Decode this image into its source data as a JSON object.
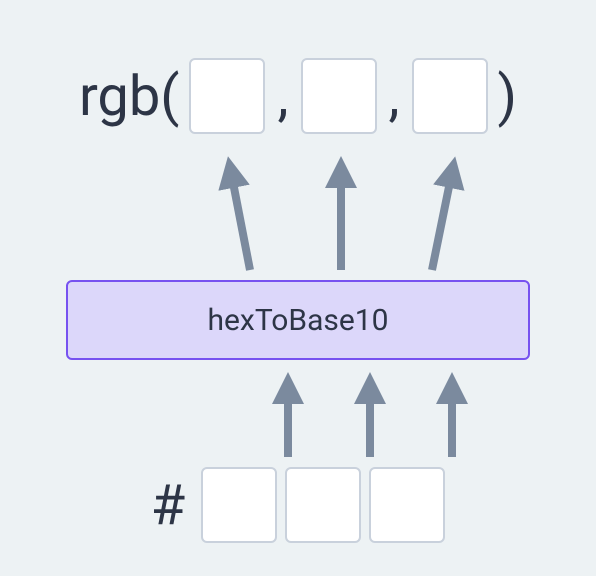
{
  "diagram": {
    "top": {
      "prefix": "rgb(",
      "comma": ",",
      "suffix": ")",
      "slots": [
        "",
        "",
        ""
      ]
    },
    "function_box": {
      "label": "hexToBase10"
    },
    "bottom": {
      "hash": "#",
      "slots": [
        "",
        "",
        ""
      ]
    },
    "arrows": {
      "color": "#7b8a9e",
      "top_from_box_count": 3,
      "bottom_to_box_count": 3
    }
  }
}
